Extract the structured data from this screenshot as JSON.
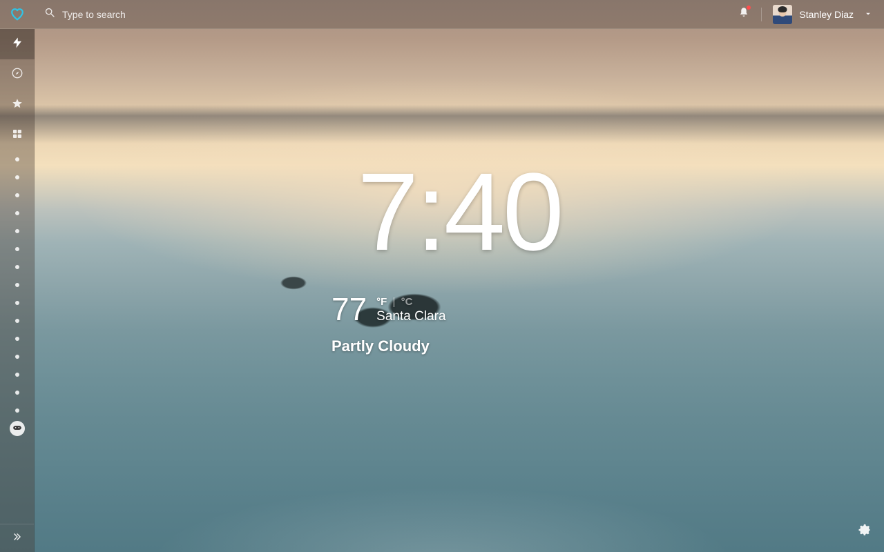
{
  "search": {
    "placeholder": "Type to search"
  },
  "user": {
    "name": "Stanley Diaz"
  },
  "clock": {
    "time": "7:40"
  },
  "weather": {
    "temp": "77",
    "unit_f_label": "°F",
    "unit_sep": "|",
    "unit_c_label": "°C",
    "location": "Santa Clara",
    "condition": "Partly Cloudy"
  },
  "sidebar": {
    "icons": [
      "bolt",
      "compass",
      "star",
      "grid"
    ],
    "dot_count": 15
  }
}
